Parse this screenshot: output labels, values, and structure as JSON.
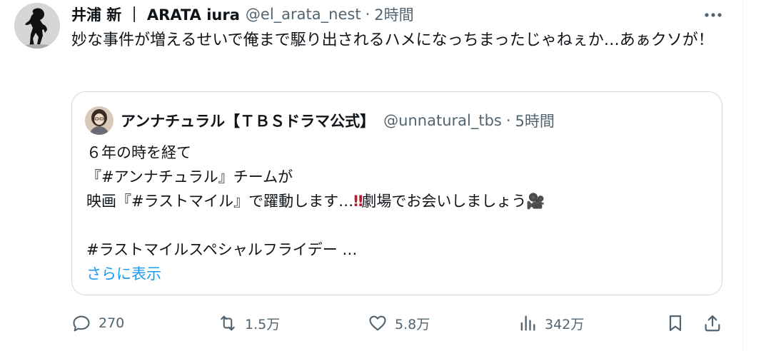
{
  "tweet": {
    "display_name": "井浦 新 ｜ ARATA iura",
    "handle": "@el_arata_nest",
    "separator": "·",
    "time": "2時間",
    "text": "妙な事件が増えるせいで俺まで駆り出されるハメになっちまったじゃねぇか…あぁクソが！"
  },
  "quote": {
    "name": "アンナチュラル【ＴＢＳドラマ公式】",
    "handle": "@unnatural_tbs",
    "separator": "·",
    "time": "5時間",
    "line1": "６年の時を経て",
    "line2": "『#アンナチュラル』チーム​が",
    "line3_a": "映画『#ラストマイル』で躍動します…",
    "line3_exclaim": "‼",
    "line3_b": "劇場でお会いしましょう",
    "line3_emoji": "🎥",
    "line4": "#ラストマイルスペシャルフライデー …",
    "show_more": "さらに表示"
  },
  "actions": {
    "reply_count": "270",
    "retweet_count": "1.5万",
    "like_count": "5.8万",
    "views_count": "342万"
  },
  "icons": {
    "more": "more-horizontal-icon",
    "reply": "reply-icon",
    "retweet": "retweet-icon",
    "like": "heart-icon",
    "views": "views-icon",
    "bookmark": "bookmark-icon",
    "share": "share-icon"
  },
  "colors": {
    "text": "#0f1419",
    "secondary": "#536471",
    "link": "#1d9bf0",
    "border": "#cfd9de"
  }
}
